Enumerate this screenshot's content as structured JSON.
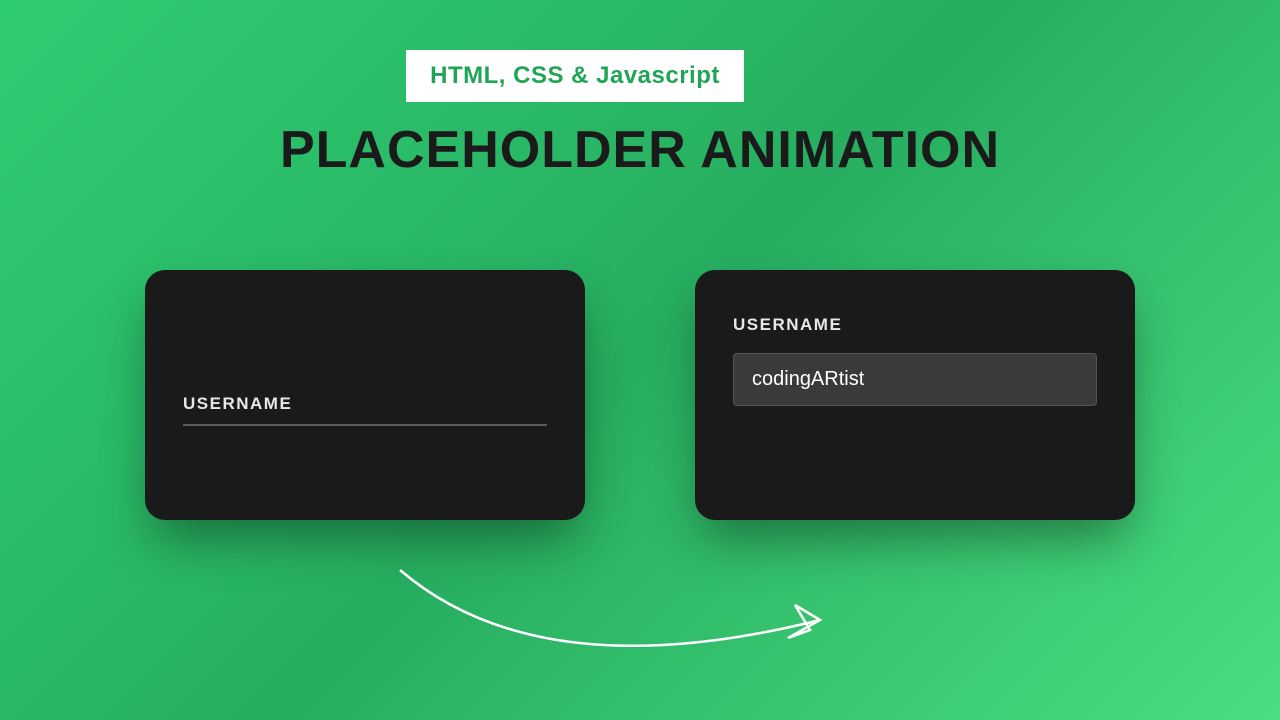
{
  "header": {
    "badge": "HTML, CSS & Javascript",
    "title": "PLACEHOLDER ANIMATION"
  },
  "cards": {
    "left": {
      "label": "USERNAME"
    },
    "right": {
      "label": "USERNAME",
      "value": "codingARtist"
    }
  },
  "colors": {
    "bg_green": "#2ecc71",
    "card_bg": "#1a1a1a",
    "input_bg": "#3a3a3a"
  }
}
